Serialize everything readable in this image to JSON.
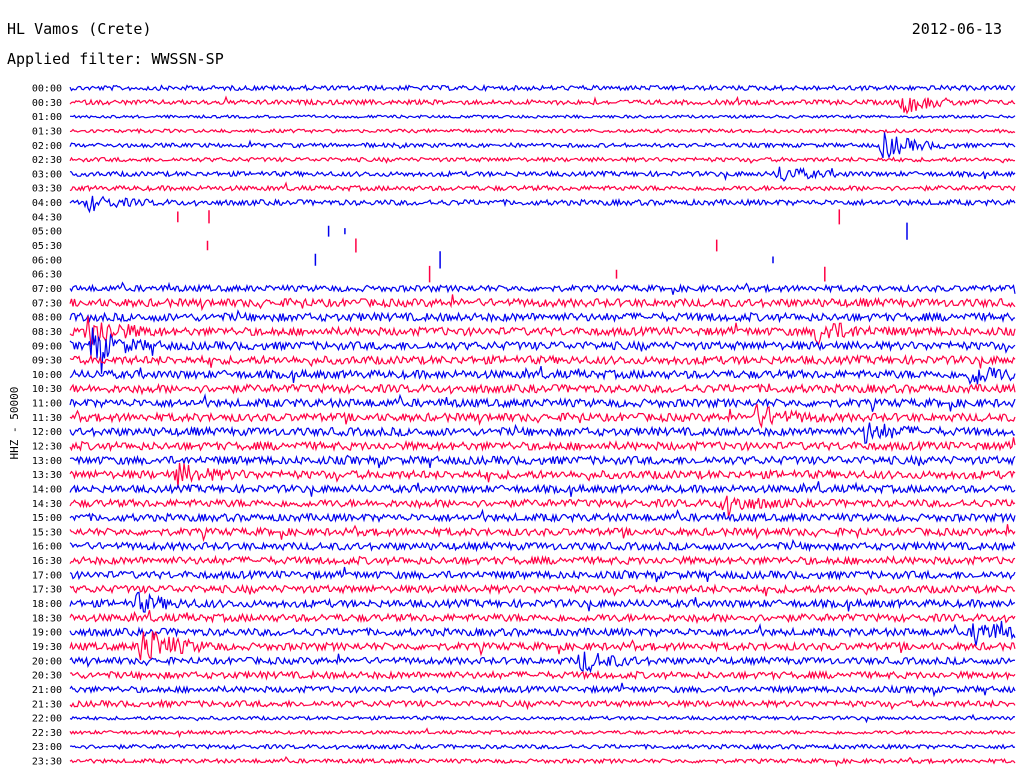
{
  "header": {
    "station": "HL Vamos (Crete)",
    "date": "2012-06-13",
    "filter": "Applied filter: WWSSN-SP"
  },
  "chart_data": {
    "type": "line",
    "title": "HL Vamos (Crete)",
    "subtitle": "Applied filter: WWSSN-SP",
    "ylabel": "HHZ - 50000",
    "xlabel": "",
    "y_ticks": [
      "00:00",
      "00:30",
      "01:00",
      "01:30",
      "02:00",
      "02:30",
      "03:00",
      "03:30",
      "04:00",
      "04:30",
      "05:00",
      "05:30",
      "06:00",
      "06:30",
      "07:00",
      "07:30",
      "08:00",
      "08:30",
      "09:00",
      "09:30",
      "10:00",
      "10:30",
      "11:00",
      "11:30",
      "12:00",
      "12:30",
      "13:00",
      "13:30",
      "14:00",
      "14:30",
      "15:00",
      "15:30",
      "16:00",
      "16:30",
      "17:00",
      "17:30",
      "18:00",
      "18:30",
      "19:00",
      "19:30",
      "20:00",
      "20:30",
      "21:00",
      "21:30",
      "22:00",
      "22:30",
      "23:00",
      "23:30"
    ],
    "trace_colors": [
      "#0000ee",
      "#ff0044"
    ],
    "gap_traces": [
      "04:30",
      "05:00",
      "05:30",
      "06:00",
      "06:30"
    ],
    "noise_level": [
      0.5,
      0.5,
      0.2,
      0.3,
      0.4,
      0.4,
      0.5,
      0.5,
      0.6,
      0,
      0,
      0,
      0,
      0,
      0.7,
      1.0,
      1.0,
      1.0,
      1.0,
      1.0,
      1.0,
      1.0,
      1.0,
      1.0,
      1.0,
      1.0,
      1.0,
      1.0,
      0.9,
      0.9,
      0.9,
      0.9,
      0.9,
      0.9,
      0.9,
      0.9,
      0.9,
      0.9,
      0.9,
      0.9,
      0.8,
      0.8,
      0.7,
      0.7,
      0.3,
      0.3,
      0.4,
      0.4
    ],
    "events": [
      {
        "trace": "00:30",
        "minute": 26.4,
        "amplitude": 1.8
      },
      {
        "trace": "02:00",
        "minute": 25.8,
        "amplitude": 2.2
      },
      {
        "trace": "03:00",
        "minute": 22.5,
        "amplitude": 1.3
      },
      {
        "trace": "04:00",
        "minute": 0.6,
        "amplitude": 1.2
      },
      {
        "trace": "08:30",
        "minute": 0.6,
        "amplitude": 3.0
      },
      {
        "trace": "09:00",
        "minute": 0.7,
        "amplitude": 2.6
      },
      {
        "trace": "08:30",
        "minute": 23.7,
        "amplitude": 2.0
      },
      {
        "trace": "10:00",
        "minute": 28.6,
        "amplitude": 1.7
      },
      {
        "trace": "11:30",
        "minute": 21.8,
        "amplitude": 1.8
      },
      {
        "trace": "12:00",
        "minute": 25.2,
        "amplitude": 1.6
      },
      {
        "trace": "13:30",
        "minute": 3.4,
        "amplitude": 1.7
      },
      {
        "trace": "14:30",
        "minute": 20.7,
        "amplitude": 1.7
      },
      {
        "trace": "18:00",
        "minute": 2.1,
        "amplitude": 1.4
      },
      {
        "trace": "19:00",
        "minute": 28.7,
        "amplitude": 1.9
      },
      {
        "trace": "19:30",
        "minute": 2.3,
        "amplitude": 3.5
      },
      {
        "trace": "20:00",
        "minute": 16.2,
        "amplitude": 1.8
      }
    ],
    "x_range_minutes": [
      0,
      30
    ],
    "grid": false,
    "legend": "none"
  }
}
